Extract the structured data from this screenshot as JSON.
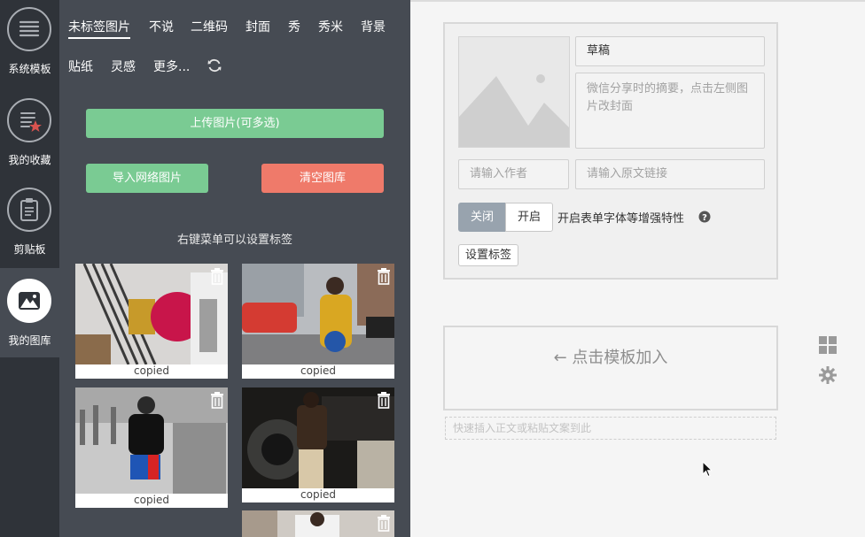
{
  "rail": {
    "items": [
      {
        "label": "系统模板",
        "icon": "template-list-icon",
        "active": false
      },
      {
        "label": "我的收藏",
        "icon": "favorite-icon",
        "active": false
      },
      {
        "label": "剪贴板",
        "icon": "clipboard-icon",
        "active": false
      },
      {
        "label": "我的图库",
        "icon": "gallery-icon",
        "active": true
      }
    ]
  },
  "library": {
    "tabs": [
      "未标签图片",
      "不说",
      "二维码",
      "封面",
      "秀",
      "秀米",
      "背景"
    ],
    "tabs_row2": [
      "贴纸",
      "灵感",
      "更多..."
    ],
    "active_tab": "未标签图片",
    "upload_button": "上传图片(可多选)",
    "import_button": "导入网络图片",
    "clear_button": "清空图库",
    "hint": "右键菜单可以设置标签",
    "images": [
      {
        "caption": "copied",
        "icon": "trash-icon"
      },
      {
        "caption": "copied",
        "icon": "trash-icon"
      },
      {
        "caption": "copied",
        "icon": "trash-icon"
      },
      {
        "caption": "copied",
        "icon": "trash-icon"
      },
      {
        "caption": "",
        "icon": "trash-icon"
      }
    ]
  },
  "editor": {
    "title_value": "草稿",
    "summary_placeholder": "微信分享时的摘要，点击左侧图片改封面",
    "author_placeholder": "请输入作者",
    "link_placeholder": "请输入原文链接",
    "toggle_off": "关闭",
    "toggle_on": "开启",
    "enhance_label": "开启表单字体等增强特性",
    "set_tag_button": "设置标签",
    "add_template_text": "← 点击模板加入",
    "paste_placeholder": "快速插入正文或粘贴文案到此"
  },
  "colors": {
    "rail_bg": "#2f3339",
    "panel_bg": "#464b53",
    "green": "#7acb93",
    "red": "#ef7a6a",
    "toggle_active": "#98a3ae"
  }
}
